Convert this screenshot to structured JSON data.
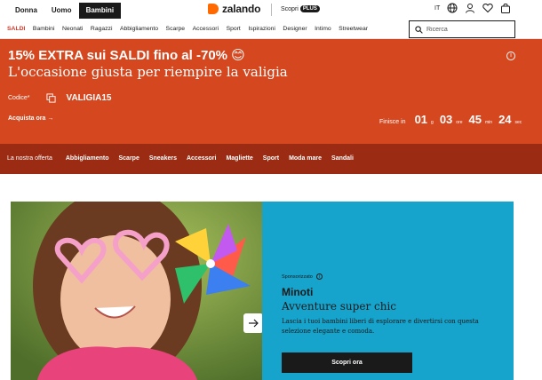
{
  "gender_tabs": [
    {
      "label": "Donna",
      "active": false
    },
    {
      "label": "Uomo",
      "active": false
    },
    {
      "label": "Bambini",
      "active": true
    }
  ],
  "brand": {
    "name": "zalando",
    "color": "#ff6900"
  },
  "plus": {
    "label": "Scopri",
    "badge": "PLUS"
  },
  "language": "IT",
  "icons": [
    "globe-icon",
    "user-icon",
    "heart-icon",
    "bag-icon",
    "search-icon",
    "copy-icon",
    "info-icon",
    "arrow-right-icon"
  ],
  "categories": [
    {
      "label": "SALDI",
      "sale": true
    },
    {
      "label": "Bambini"
    },
    {
      "label": "Neonati"
    },
    {
      "label": "Ragazzi"
    },
    {
      "label": "Abbigliamento"
    },
    {
      "label": "Scarpe"
    },
    {
      "label": "Accessori"
    },
    {
      "label": "Sport"
    },
    {
      "label": "Ispirazioni"
    },
    {
      "label": "Designer"
    },
    {
      "label": "Intimo"
    },
    {
      "label": "Streetwear"
    }
  ],
  "search": {
    "placeholder": "Ricerca"
  },
  "promo": {
    "headline": "15% EXTRA sui SALDI fino al -70% 😊",
    "subheadline": "L'occasione giusta per riempire la valigia",
    "code_label": "Codice*",
    "code": "VALIGIA15",
    "cta": "Acquista ora →",
    "countdown_label": "Finisce in",
    "countdown": [
      {
        "value": "01",
        "unit": "g"
      },
      {
        "value": "03",
        "unit": "ore"
      },
      {
        "value": "45",
        "unit": "min"
      },
      {
        "value": "24",
        "unit": "sec"
      }
    ],
    "bg_color": "#d5471f"
  },
  "offer": {
    "title": "La nostra offerta",
    "items": [
      "Abbigliamento",
      "Scarpe",
      "Sneakers",
      "Accessori",
      "Magliette",
      "Sport",
      "Moda mare",
      "Sandali"
    ],
    "bg_color": "#9b2b12"
  },
  "hero": {
    "sponsored_label": "Sponsorizzato",
    "brand": "Minoti",
    "title": "Avventure super chic",
    "description": "Lascia i tuoi bambini liberi di esplorare e divertirsi con questa selezione elegante e comoda.",
    "cta": "Scopri ora",
    "panel_color": "#16a3cc"
  }
}
